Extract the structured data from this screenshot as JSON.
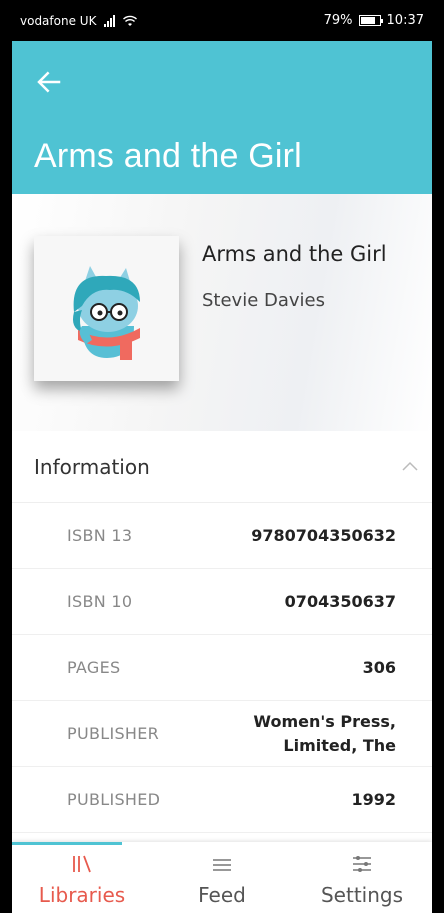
{
  "status_bar": {
    "carrier": "vodafone UK",
    "battery_percent": "79%",
    "time": "10:37",
    "battery_level": 0.79
  },
  "app_bar": {
    "title": "Arms and the Girl",
    "back_icon": "arrow-left-icon",
    "color": "#4fc3d3"
  },
  "book": {
    "title": "Arms and the Girl",
    "author": "Stevie Davies",
    "cover_icon": "mascot-illustration"
  },
  "information": {
    "label": "Information",
    "toggle_icon": "chevron-up-icon",
    "rows": [
      {
        "label": "ISBN 13",
        "value": "9780704350632"
      },
      {
        "label": "ISBN 10",
        "value": "0704350637"
      },
      {
        "label": "PAGES",
        "value": "306"
      },
      {
        "label": "PUBLISHER",
        "value": "Women's Press, Limited, The"
      },
      {
        "label": "PUBLISHED",
        "value": "1992"
      }
    ]
  },
  "bottom_nav": {
    "accent": "#e75a4d",
    "items": [
      {
        "label": "Libraries",
        "icon": "library-icon",
        "active": true
      },
      {
        "label": "Feed",
        "icon": "menu-icon",
        "active": false
      },
      {
        "label": "Settings",
        "icon": "sliders-icon",
        "active": false
      }
    ]
  }
}
